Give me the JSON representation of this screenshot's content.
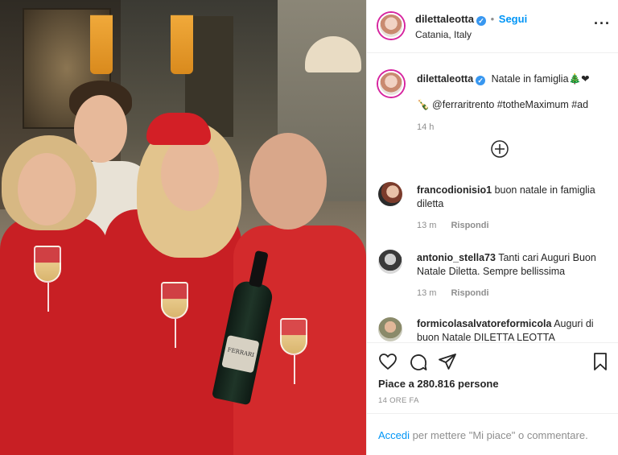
{
  "post": {
    "username": "dilettaleotta",
    "follow_label": "Segui",
    "location": "Catania, Italy",
    "more_icon": "more-horizontal-icon"
  },
  "caption": {
    "username": "dilettaleotta",
    "text": "Natale in famiglia🎄❤",
    "line2": "🍾 @ferraritrento #totheMaximum #ad",
    "time": "14 h"
  },
  "load_more_icon": "plus-circle-icon",
  "comments": [
    {
      "username": "francodionisio1",
      "text": "buon natale in famiglia diletta",
      "time": "13 m",
      "reply": "Rispondi"
    },
    {
      "username": "antonio_stella73",
      "text": "Tanti cari Auguri Buon Natale Diletta. Sempre bellissima",
      "time": "13 m",
      "reply": "Rispondi"
    },
    {
      "username": "formicolasalvatoreformicola",
      "text": "Auguri di buon Natale DILETTA LEOTTA"
    }
  ],
  "actions": {
    "likes": "Piace a 280.816 persone",
    "timestamp": "14 ORE FA"
  },
  "login": {
    "link": "Accedi",
    "text": "per mettere \"Mi piace\" o commentare."
  },
  "photo_text": {
    "bottle_label": "FERRARI"
  },
  "colors": {
    "link_blue": "#0095f6",
    "verified_blue": "#3897f0",
    "caption_link": "#003569",
    "sweater_red": "#c81f24"
  }
}
